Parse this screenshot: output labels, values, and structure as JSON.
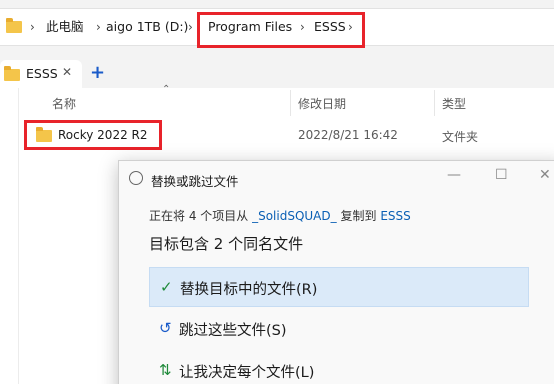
{
  "breadcrumb": {
    "items": [
      "此电脑",
      "aigo 1TB (D:)",
      "Program Files",
      "ESSS"
    ],
    "separator": "›"
  },
  "tabs": [
    {
      "label": "ESSS",
      "close": "✕"
    }
  ],
  "new_tab": "+",
  "columns": {
    "name": "名称",
    "modified": "修改日期",
    "type": "类型"
  },
  "rows": [
    {
      "name": "Rocky 2022 R2",
      "modified": "2022/8/21 16:42",
      "type": "文件夹"
    }
  ],
  "dialog": {
    "title": "替换或跳过文件",
    "info_prefix": "正在将 4 个项目从",
    "source": "_SolidSQUAD_",
    "info_mid": "复制到",
    "dest": "ESSS",
    "heading": "目标包含 2 个同名文件",
    "options": [
      {
        "label": "替换目标中的文件(R)",
        "icon": "check-icon",
        "selected": true
      },
      {
        "label": "跳过这些文件(S)",
        "icon": "skip-icon",
        "selected": false
      },
      {
        "label": "让我决定每个文件(L)",
        "icon": "decide-icon",
        "selected": false
      }
    ]
  },
  "colors": {
    "highlight": "#e8232a",
    "selected_bg": "#dbeaf9",
    "link": "#0a5fb4",
    "check": "#1f8a3a"
  }
}
